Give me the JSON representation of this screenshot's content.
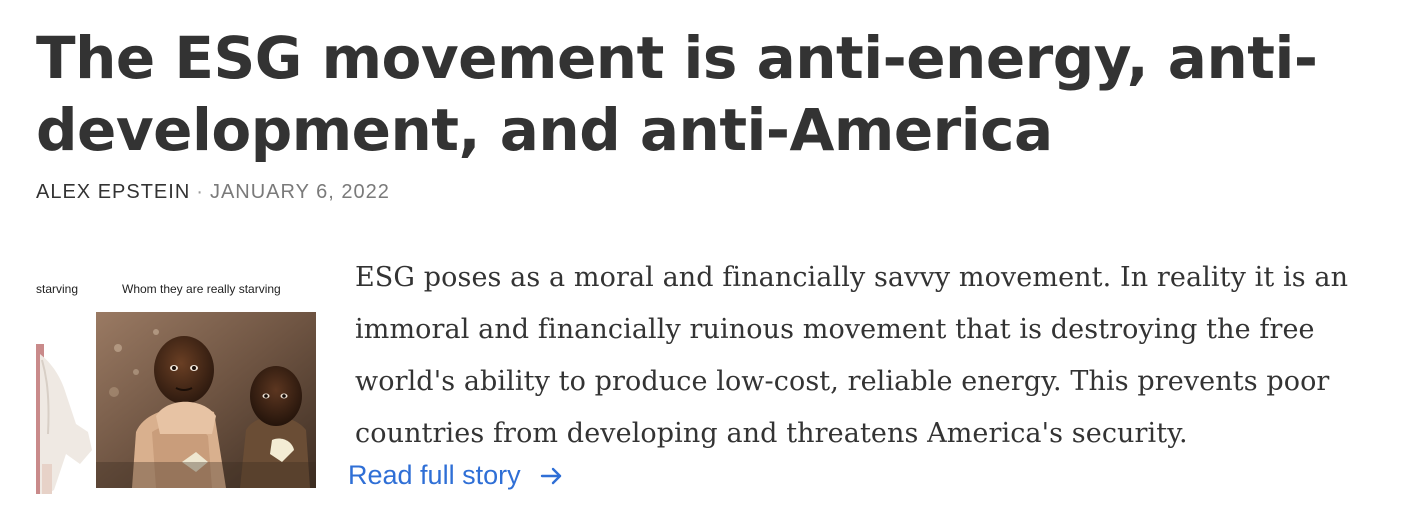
{
  "article": {
    "title": "The ESG movement is anti-energy, anti-development, and anti-America",
    "author": "ALEX EPSTEIN",
    "separator": "·",
    "date": "JANUARY 6, 2022",
    "summary": "ESG poses as a moral and financially savvy movement. In reality it is an immoral and financially ruinous movement that is destroying the free world's ability to produce low-cost, reliable energy. This prevents poor countries from developing and threatens America's security.",
    "read_more_label": "Read full story",
    "read_more_icon": "arrow-right-icon"
  },
  "image": {
    "caption_left": "starving",
    "caption_right": "Whom they are really starving"
  },
  "colors": {
    "text": "#333333",
    "meta": "#7a7a7a",
    "link": "#2f6fd6"
  }
}
